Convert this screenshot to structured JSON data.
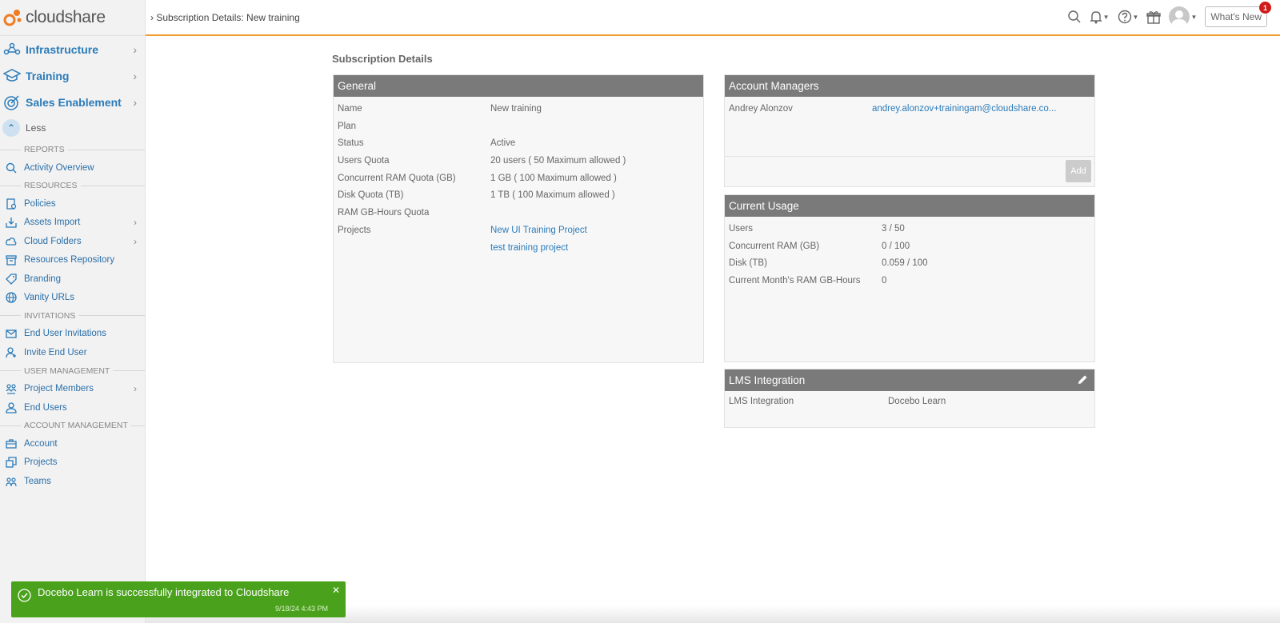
{
  "app": {
    "logo_text": "cloudshare"
  },
  "breadcrumb": "› Subscription Details: New training",
  "header": {
    "whats_new": "What's New",
    "badge_count": "1"
  },
  "sidebar": {
    "main_items": [
      {
        "label": "Infrastructure"
      },
      {
        "label": "Training"
      },
      {
        "label": "Sales Enablement"
      }
    ],
    "less_label": "Less",
    "sections": {
      "reports": "REPORTS",
      "resources": "RESOURCES",
      "invitations": "INVITATIONS",
      "user_management": "USER MANAGEMENT",
      "account_management": "ACCOUNT MANAGEMENT"
    },
    "items": {
      "activity_overview": "Activity Overview",
      "policies": "Policies",
      "assets_import": "Assets Import",
      "cloud_folders": "Cloud Folders",
      "resources_repository": "Resources Repository",
      "branding": "Branding",
      "vanity_urls": "Vanity URLs",
      "end_user_invitations": "End User Invitations",
      "invite_end_user": "Invite End User",
      "project_members": "Project Members",
      "end_users": "End Users",
      "account": "Account",
      "projects": "Projects",
      "teams": "Teams"
    }
  },
  "main": {
    "title": "Subscription Details",
    "general": {
      "heading": "General",
      "rows": [
        {
          "label": "Name",
          "value": "New training"
        },
        {
          "label": "Plan",
          "value": ""
        },
        {
          "label": "Status",
          "value": "Active"
        },
        {
          "label": "Users Quota",
          "value": "20 users ( 50 Maximum allowed )"
        },
        {
          "label": "Concurrent RAM Quota (GB)",
          "value": "1 GB ( 100 Maximum allowed )"
        },
        {
          "label": "Disk Quota (TB)",
          "value": "1 TB ( 100 Maximum allowed )"
        },
        {
          "label": "RAM GB-Hours Quota",
          "value": ""
        },
        {
          "label": "Projects",
          "value": ""
        }
      ],
      "projects": [
        "New UI Training Project",
        "test training project"
      ]
    },
    "account_managers": {
      "heading": "Account Managers",
      "name": "Andrey Alonzov",
      "email": "andrey.alonzov+trainingam@cloudshare.co...",
      "add_label": "Add"
    },
    "current_usage": {
      "heading": "Current Usage",
      "rows": [
        {
          "label": "Users",
          "value": "3 / 50"
        },
        {
          "label": "Concurrent RAM (GB)",
          "value": "0 / 100"
        },
        {
          "label": "Disk (TB)",
          "value": "0.059 / 100"
        },
        {
          "label": "Current Month's RAM GB-Hours",
          "value": "0"
        }
      ]
    },
    "lms": {
      "heading": "LMS Integration",
      "label": "LMS Integration",
      "value": "Docebo Learn"
    }
  },
  "toast": {
    "message": "Docebo Learn is successfully integrated to Cloudshare",
    "time": "9/18/24 4:43 PM",
    "close": "✕"
  },
  "colors": {
    "accent": "#2b7bb9",
    "topbar_border": "#f0a030",
    "panel_header": "#7a7a7a",
    "toast_bg": "#4aa21c",
    "badge": "#d01919"
  }
}
